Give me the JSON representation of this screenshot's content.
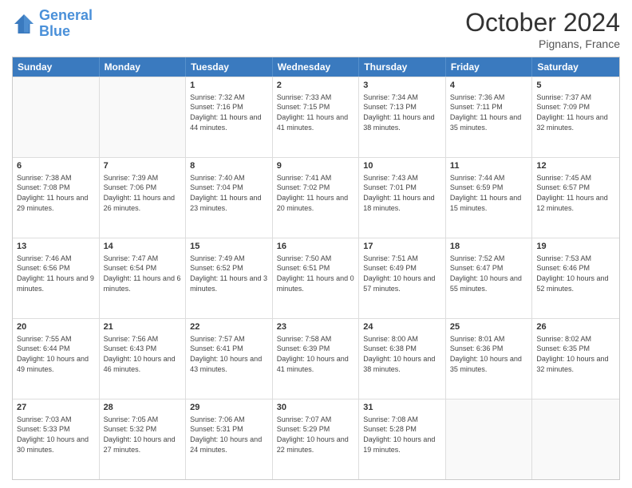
{
  "header": {
    "logo_line1": "General",
    "logo_line2": "Blue",
    "month": "October 2024",
    "location": "Pignans, France"
  },
  "days_of_week": [
    "Sunday",
    "Monday",
    "Tuesday",
    "Wednesday",
    "Thursday",
    "Friday",
    "Saturday"
  ],
  "rows": [
    [
      {
        "day": "",
        "info": ""
      },
      {
        "day": "",
        "info": ""
      },
      {
        "day": "1",
        "info": "Sunrise: 7:32 AM\nSunset: 7:16 PM\nDaylight: 11 hours and 44 minutes."
      },
      {
        "day": "2",
        "info": "Sunrise: 7:33 AM\nSunset: 7:15 PM\nDaylight: 11 hours and 41 minutes."
      },
      {
        "day": "3",
        "info": "Sunrise: 7:34 AM\nSunset: 7:13 PM\nDaylight: 11 hours and 38 minutes."
      },
      {
        "day": "4",
        "info": "Sunrise: 7:36 AM\nSunset: 7:11 PM\nDaylight: 11 hours and 35 minutes."
      },
      {
        "day": "5",
        "info": "Sunrise: 7:37 AM\nSunset: 7:09 PM\nDaylight: 11 hours and 32 minutes."
      }
    ],
    [
      {
        "day": "6",
        "info": "Sunrise: 7:38 AM\nSunset: 7:08 PM\nDaylight: 11 hours and 29 minutes."
      },
      {
        "day": "7",
        "info": "Sunrise: 7:39 AM\nSunset: 7:06 PM\nDaylight: 11 hours and 26 minutes."
      },
      {
        "day": "8",
        "info": "Sunrise: 7:40 AM\nSunset: 7:04 PM\nDaylight: 11 hours and 23 minutes."
      },
      {
        "day": "9",
        "info": "Sunrise: 7:41 AM\nSunset: 7:02 PM\nDaylight: 11 hours and 20 minutes."
      },
      {
        "day": "10",
        "info": "Sunrise: 7:43 AM\nSunset: 7:01 PM\nDaylight: 11 hours and 18 minutes."
      },
      {
        "day": "11",
        "info": "Sunrise: 7:44 AM\nSunset: 6:59 PM\nDaylight: 11 hours and 15 minutes."
      },
      {
        "day": "12",
        "info": "Sunrise: 7:45 AM\nSunset: 6:57 PM\nDaylight: 11 hours and 12 minutes."
      }
    ],
    [
      {
        "day": "13",
        "info": "Sunrise: 7:46 AM\nSunset: 6:56 PM\nDaylight: 11 hours and 9 minutes."
      },
      {
        "day": "14",
        "info": "Sunrise: 7:47 AM\nSunset: 6:54 PM\nDaylight: 11 hours and 6 minutes."
      },
      {
        "day": "15",
        "info": "Sunrise: 7:49 AM\nSunset: 6:52 PM\nDaylight: 11 hours and 3 minutes."
      },
      {
        "day": "16",
        "info": "Sunrise: 7:50 AM\nSunset: 6:51 PM\nDaylight: 11 hours and 0 minutes."
      },
      {
        "day": "17",
        "info": "Sunrise: 7:51 AM\nSunset: 6:49 PM\nDaylight: 10 hours and 57 minutes."
      },
      {
        "day": "18",
        "info": "Sunrise: 7:52 AM\nSunset: 6:47 PM\nDaylight: 10 hours and 55 minutes."
      },
      {
        "day": "19",
        "info": "Sunrise: 7:53 AM\nSunset: 6:46 PM\nDaylight: 10 hours and 52 minutes."
      }
    ],
    [
      {
        "day": "20",
        "info": "Sunrise: 7:55 AM\nSunset: 6:44 PM\nDaylight: 10 hours and 49 minutes."
      },
      {
        "day": "21",
        "info": "Sunrise: 7:56 AM\nSunset: 6:43 PM\nDaylight: 10 hours and 46 minutes."
      },
      {
        "day": "22",
        "info": "Sunrise: 7:57 AM\nSunset: 6:41 PM\nDaylight: 10 hours and 43 minutes."
      },
      {
        "day": "23",
        "info": "Sunrise: 7:58 AM\nSunset: 6:39 PM\nDaylight: 10 hours and 41 minutes."
      },
      {
        "day": "24",
        "info": "Sunrise: 8:00 AM\nSunset: 6:38 PM\nDaylight: 10 hours and 38 minutes."
      },
      {
        "day": "25",
        "info": "Sunrise: 8:01 AM\nSunset: 6:36 PM\nDaylight: 10 hours and 35 minutes."
      },
      {
        "day": "26",
        "info": "Sunrise: 8:02 AM\nSunset: 6:35 PM\nDaylight: 10 hours and 32 minutes."
      }
    ],
    [
      {
        "day": "27",
        "info": "Sunrise: 7:03 AM\nSunset: 5:33 PM\nDaylight: 10 hours and 30 minutes."
      },
      {
        "day": "28",
        "info": "Sunrise: 7:05 AM\nSunset: 5:32 PM\nDaylight: 10 hours and 27 minutes."
      },
      {
        "day": "29",
        "info": "Sunrise: 7:06 AM\nSunset: 5:31 PM\nDaylight: 10 hours and 24 minutes."
      },
      {
        "day": "30",
        "info": "Sunrise: 7:07 AM\nSunset: 5:29 PM\nDaylight: 10 hours and 22 minutes."
      },
      {
        "day": "31",
        "info": "Sunrise: 7:08 AM\nSunset: 5:28 PM\nDaylight: 10 hours and 19 minutes."
      },
      {
        "day": "",
        "info": ""
      },
      {
        "day": "",
        "info": ""
      }
    ]
  ]
}
